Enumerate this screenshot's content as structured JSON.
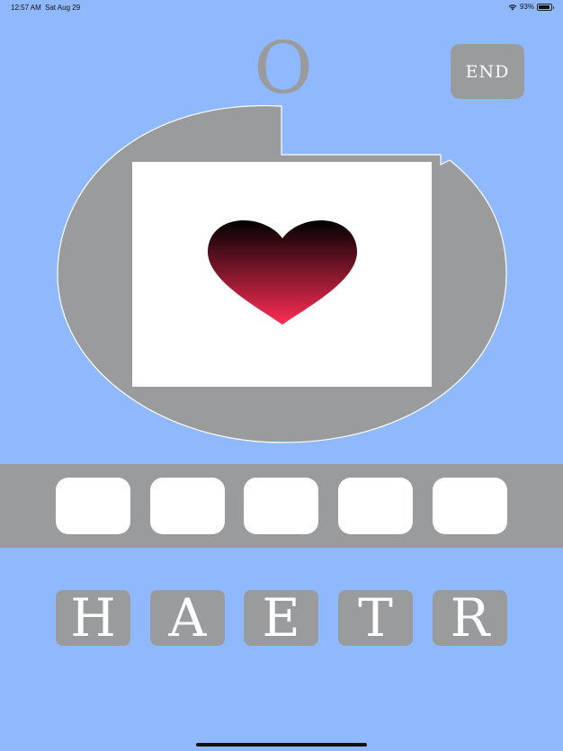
{
  "status_bar": {
    "time": "12:57 AM",
    "date": "Sat Aug 29",
    "battery": "93%",
    "battery_level": 0.93
  },
  "hint_letter": "O",
  "end_button": {
    "label": "END"
  },
  "picture": {
    "icon": "heart-icon",
    "gradient_top": "#000000",
    "gradient_bottom": "#ff2d55"
  },
  "answer_slots": [
    "",
    "",
    "",
    "",
    ""
  ],
  "letter_tiles": [
    "H",
    "A",
    "E",
    "T",
    "R"
  ],
  "colors": {
    "background": "#8fb8fd",
    "gray": "#9a9b9d",
    "slot": "#ffffff"
  }
}
